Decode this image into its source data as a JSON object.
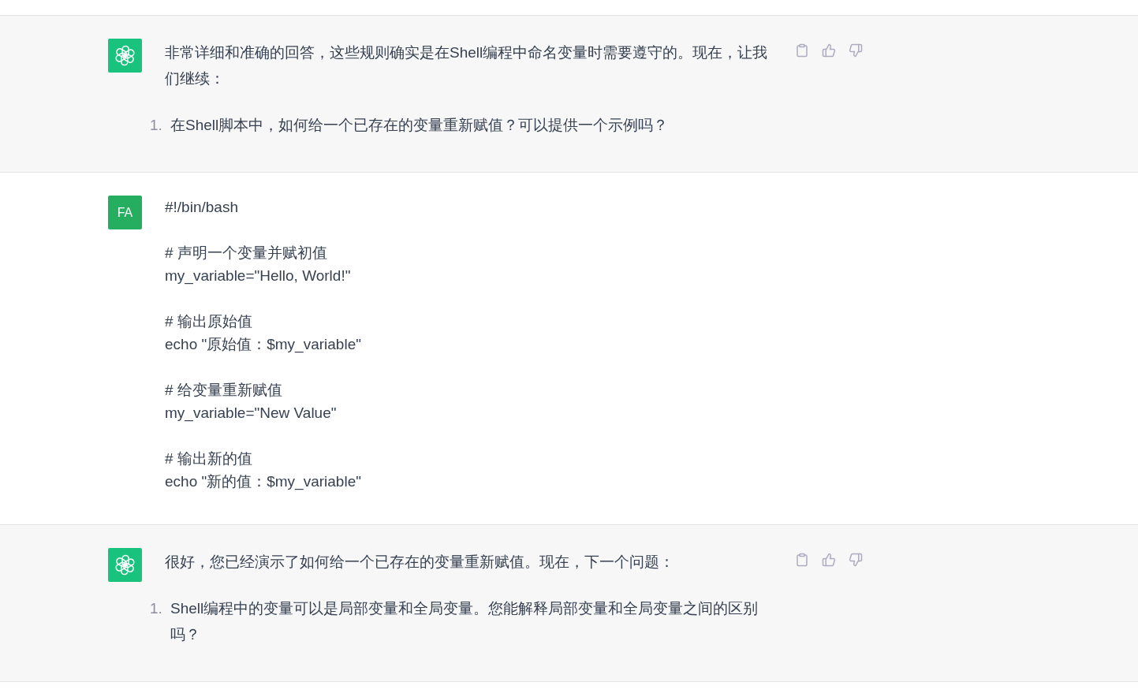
{
  "messages": [
    {
      "kind": "assistant",
      "paragraph": "非常详细和准确的回答，这些规则确实是在Shell编程中命名变量时需要遵守的。现在，让我们继续：",
      "list": [
        {
          "number": "1.",
          "text": "在Shell脚本中，如何给一个已存在的变量重新赋值？可以提供一个示例吗？"
        }
      ]
    },
    {
      "kind": "user",
      "avatar": "FA",
      "groups": [
        [
          "#!/bin/bash"
        ],
        [
          "# 声明一个变量并赋初值",
          "my_variable=\"Hello, World!\""
        ],
        [
          "# 输出原始值",
          "echo \"原始值：$my_variable\""
        ],
        [
          "# 给变量重新赋值",
          "my_variable=\"New Value\""
        ],
        [
          "# 输出新的值",
          "echo \"新的值：$my_variable\""
        ]
      ]
    },
    {
      "kind": "assistant",
      "paragraph": "很好，您已经演示了如何给一个已存在的变量重新赋值。现在，下一个问题：",
      "list": [
        {
          "number": "1.",
          "text": "Shell编程中的变量可以是局部变量和全局变量。您能解释局部变量和全局变量之间的区别吗？"
        }
      ]
    }
  ]
}
